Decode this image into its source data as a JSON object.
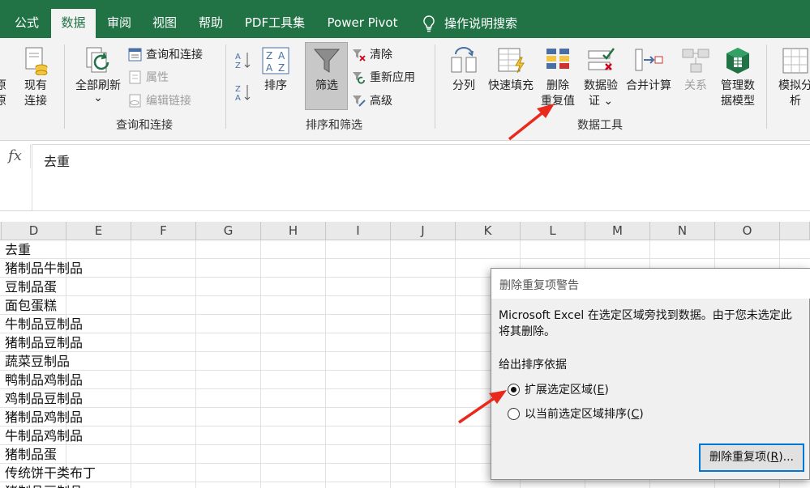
{
  "tabs": [
    "公式",
    "数据",
    "审阅",
    "视图",
    "帮助",
    "PDF工具集",
    "Power Pivot"
  ],
  "tell_me": "操作说明搜索",
  "ribbon": {
    "get_data_partial": [
      "现有",
      "连接"
    ],
    "refresh_all": "全部刷新",
    "refresh_dropdown": "⌄",
    "queries_connections": "查询和连接",
    "properties": "属性",
    "edit_links": "编辑链接",
    "group_queries": "查询和连接",
    "sort": "排序",
    "filter": "筛选",
    "clear": "清除",
    "reapply": "重新应用",
    "advanced": "高级",
    "group_sort_filter": "排序和筛选",
    "text_to_columns": "分列",
    "flash_fill": "快速填充",
    "remove_duplicates": [
      "删除",
      "重复值"
    ],
    "data_validation": [
      "数据验",
      "证 ⌄"
    ],
    "consolidate": "合并计算",
    "relationships": "关系",
    "manage_model": [
      "管理数",
      "据模型"
    ],
    "what_if": [
      "模拟分",
      "析"
    ],
    "group_data_tools": "数据工具"
  },
  "formula_bar": {
    "fx": "fx",
    "value": "去重"
  },
  "columns": [
    "D",
    "E",
    "F",
    "G",
    "H",
    "I",
    "J",
    "K",
    "L",
    "M",
    "N",
    "O"
  ],
  "column_d_values": [
    "去重",
    "猪制品牛制品",
    "豆制品蛋",
    "面包蛋糕",
    "牛制品豆制品",
    "猪制品豆制品",
    "蔬菜豆制品",
    "鸭制品鸡制品",
    "鸡制品豆制品",
    "猪制品鸡制品",
    "牛制品鸡制品",
    "猪制品蛋",
    "传统饼干类布丁",
    "猪制品豆制品"
  ],
  "dialog": {
    "title": "删除重复项警告",
    "message_line1": "Microsoft Excel 在选定区域旁找到数据。由于您未选定此",
    "message_line2": "将其删除。",
    "section": "给出排序依据",
    "option1": "扩展选定区域(",
    "option1_key": "E",
    "option1_end": ")",
    "option2": "以当前选定区域排序(",
    "option2_key": "C",
    "option2_end": ")",
    "button": "删除重复项(",
    "button_key": "R",
    "button_end": ")..."
  },
  "colors": {
    "brand_green": "#217346",
    "arrow_red": "#e8291c",
    "focus_blue": "#0078d7"
  }
}
